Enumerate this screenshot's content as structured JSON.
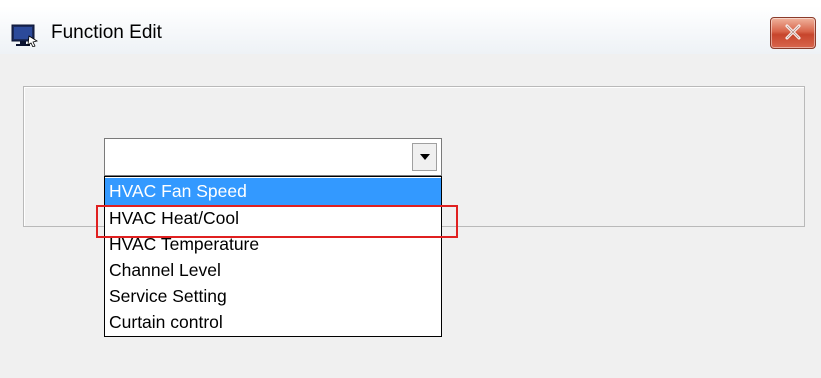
{
  "window": {
    "title": "Function Edit"
  },
  "combo": {
    "value": ""
  },
  "dropdown": {
    "options": [
      "HVAC Fan Speed",
      "HVAC Heat/Cool",
      "HVAC Temperature",
      "Channel Level",
      "Service Setting",
      "Curtain control"
    ],
    "selected_index": 0,
    "highlighted_index": 1
  },
  "colors": {
    "selection": "#3399ff",
    "annotation_box": "#e02020",
    "close_button": "#c7452c"
  },
  "icons": {
    "title": "app-window-icon",
    "close": "close-icon",
    "combo_arrow": "chevron-down-icon"
  }
}
